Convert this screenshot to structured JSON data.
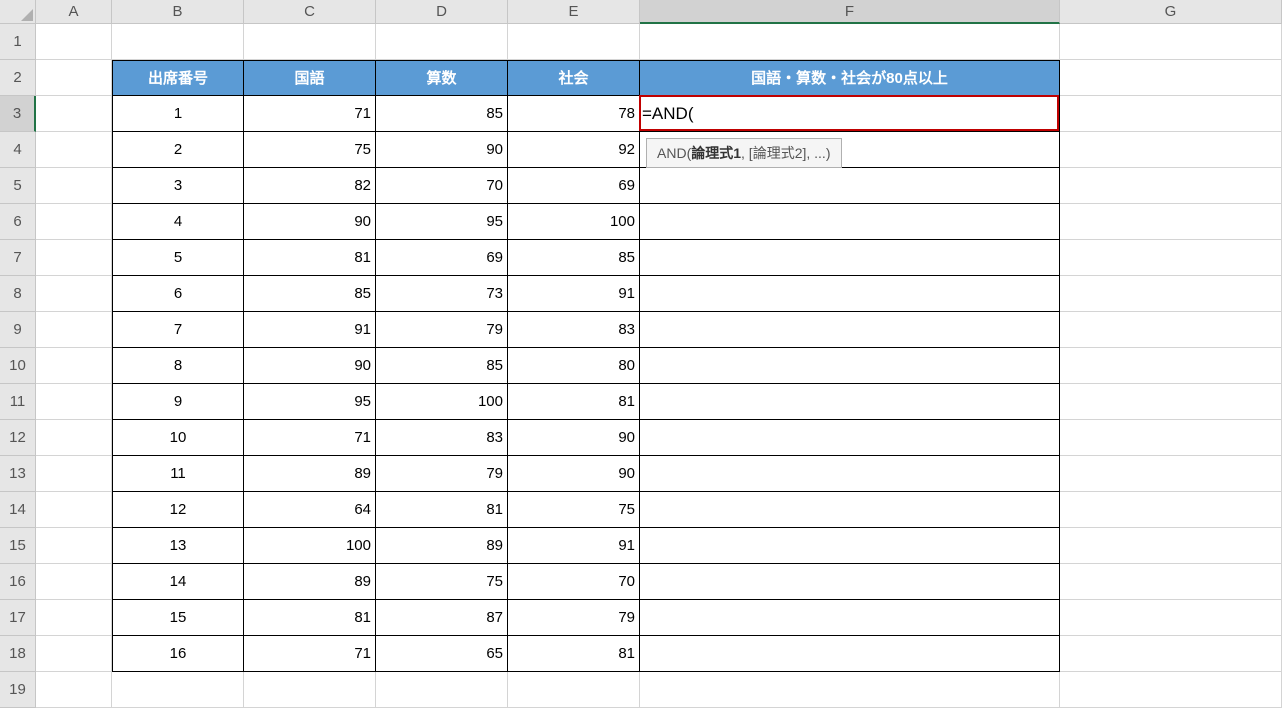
{
  "columns": [
    "A",
    "B",
    "C",
    "D",
    "E",
    "F",
    "G"
  ],
  "selectedColumn": "F",
  "selectedRow": 3,
  "rowCount": 19,
  "headerRow": 2,
  "headers": {
    "B": "出席番号",
    "C": "国語",
    "D": "算数",
    "E": "社会",
    "F": "国語・算数・社会が80点以上"
  },
  "dataStartRow": 3,
  "dataEndRow": 18,
  "data": [
    {
      "B": "1",
      "C": "71",
      "D": "85",
      "E": "78"
    },
    {
      "B": "2",
      "C": "75",
      "D": "90",
      "E": "92"
    },
    {
      "B": "3",
      "C": "82",
      "D": "70",
      "E": "69"
    },
    {
      "B": "4",
      "C": "90",
      "D": "95",
      "E": "100"
    },
    {
      "B": "5",
      "C": "81",
      "D": "69",
      "E": "85"
    },
    {
      "B": "6",
      "C": "85",
      "D": "73",
      "E": "91"
    },
    {
      "B": "7",
      "C": "91",
      "D": "79",
      "E": "83"
    },
    {
      "B": "8",
      "C": "90",
      "D": "85",
      "E": "80"
    },
    {
      "B": "9",
      "C": "95",
      "D": "100",
      "E": "81"
    },
    {
      "B": "10",
      "C": "71",
      "D": "83",
      "E": "90"
    },
    {
      "B": "11",
      "C": "89",
      "D": "79",
      "E": "90"
    },
    {
      "B": "12",
      "C": "64",
      "D": "81",
      "E": "75"
    },
    {
      "B": "13",
      "C": "100",
      "D": "89",
      "E": "91"
    },
    {
      "B": "14",
      "C": "89",
      "D": "75",
      "E": "70"
    },
    {
      "B": "15",
      "C": "81",
      "D": "87",
      "E": "79"
    },
    {
      "B": "16",
      "C": "71",
      "D": "65",
      "E": "81"
    }
  ],
  "activeCell": {
    "ref": "F3",
    "formula": "=AND("
  },
  "tooltip": {
    "fn": "AND",
    "boldArg": "論理式1",
    "restArgs": ", [論理式2], ...)"
  },
  "chart_data": {
    "type": "table",
    "title": "国語・算数・社会が80点以上",
    "columns": [
      "出席番号",
      "国語",
      "算数",
      "社会"
    ],
    "rows": [
      [
        1,
        71,
        85,
        78
      ],
      [
        2,
        75,
        90,
        92
      ],
      [
        3,
        82,
        70,
        69
      ],
      [
        4,
        90,
        95,
        100
      ],
      [
        5,
        81,
        69,
        85
      ],
      [
        6,
        85,
        73,
        91
      ],
      [
        7,
        91,
        79,
        83
      ],
      [
        8,
        90,
        85,
        80
      ],
      [
        9,
        95,
        100,
        81
      ],
      [
        10,
        71,
        83,
        90
      ],
      [
        11,
        89,
        79,
        90
      ],
      [
        12,
        64,
        81,
        75
      ],
      [
        13,
        100,
        89,
        91
      ],
      [
        14,
        89,
        75,
        70
      ],
      [
        15,
        81,
        87,
        79
      ],
      [
        16,
        71,
        65,
        81
      ]
    ]
  }
}
